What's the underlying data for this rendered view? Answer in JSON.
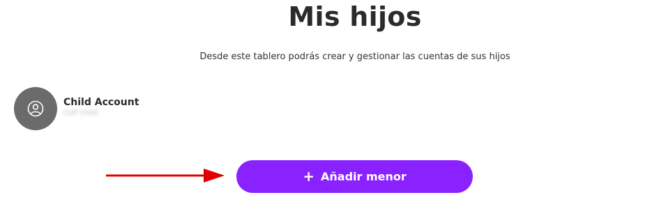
{
  "header": {
    "title": "Mis hijos",
    "subtitle": "Desde este tablero podrás crear y gestionar las cuentas de sus hijos"
  },
  "children": [
    {
      "name": "Child Account",
      "detail": "CUP Child",
      "icon": "user-circle-icon"
    }
  ],
  "actions": {
    "add_label": "Añadir menor",
    "add_icon": "plus-icon"
  },
  "colors": {
    "accent": "#8a22ff",
    "avatar_bg": "#6b6b6b",
    "annotation_arrow": "#e00000"
  }
}
